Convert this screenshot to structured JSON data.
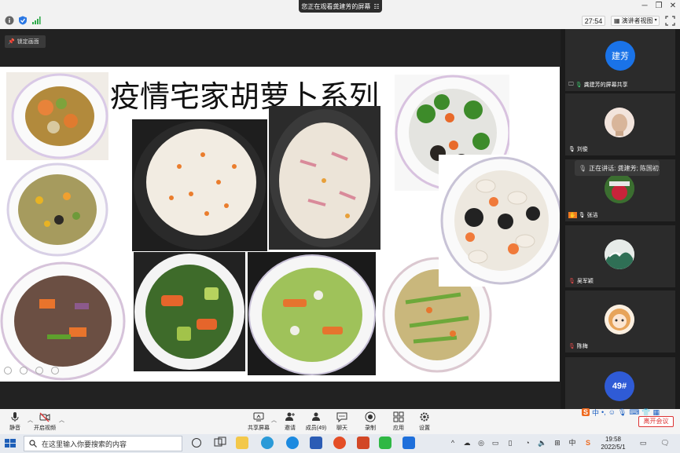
{
  "window": {
    "share_banner": "您正在观看龚建芳的屏幕",
    "timer": "27:54",
    "view_label": "演讲者视图"
  },
  "share": {
    "lock_label": "锁定画面",
    "slide_title": "疫情宅家胡萝卜系列"
  },
  "panel": {
    "tiles": [
      {
        "name": "龚建芳的屏幕共享",
        "avatar_text": "建芳",
        "avatar_color": "#1a73e8"
      },
      {
        "name": "刘俊"
      },
      {
        "name": "张洁"
      },
      {
        "name": "吴军颖"
      },
      {
        "name": "陈梅"
      },
      {
        "name": "",
        "avatar_text": "49#"
      }
    ],
    "speaking": "正在讲话: 龚建芳; 陈国初;"
  },
  "toolbar": {
    "mute": "静音",
    "video": "开启视频",
    "share_screen": "共享屏幕",
    "invite": "邀请",
    "members": "成员(49)",
    "chat": "聊天",
    "record": "录制",
    "apps": "应用",
    "settings": "设置",
    "leave": "离开会议"
  },
  "ime": {
    "lang": "中"
  },
  "taskbar": {
    "search_placeholder": "在这里输入你要搜索的内容",
    "time": "19:58",
    "date": "2022/5/1"
  },
  "colors": {
    "accent": "#1a73e8",
    "leave_red": "#dd3333",
    "panel_bg": "#1b1b1b"
  }
}
